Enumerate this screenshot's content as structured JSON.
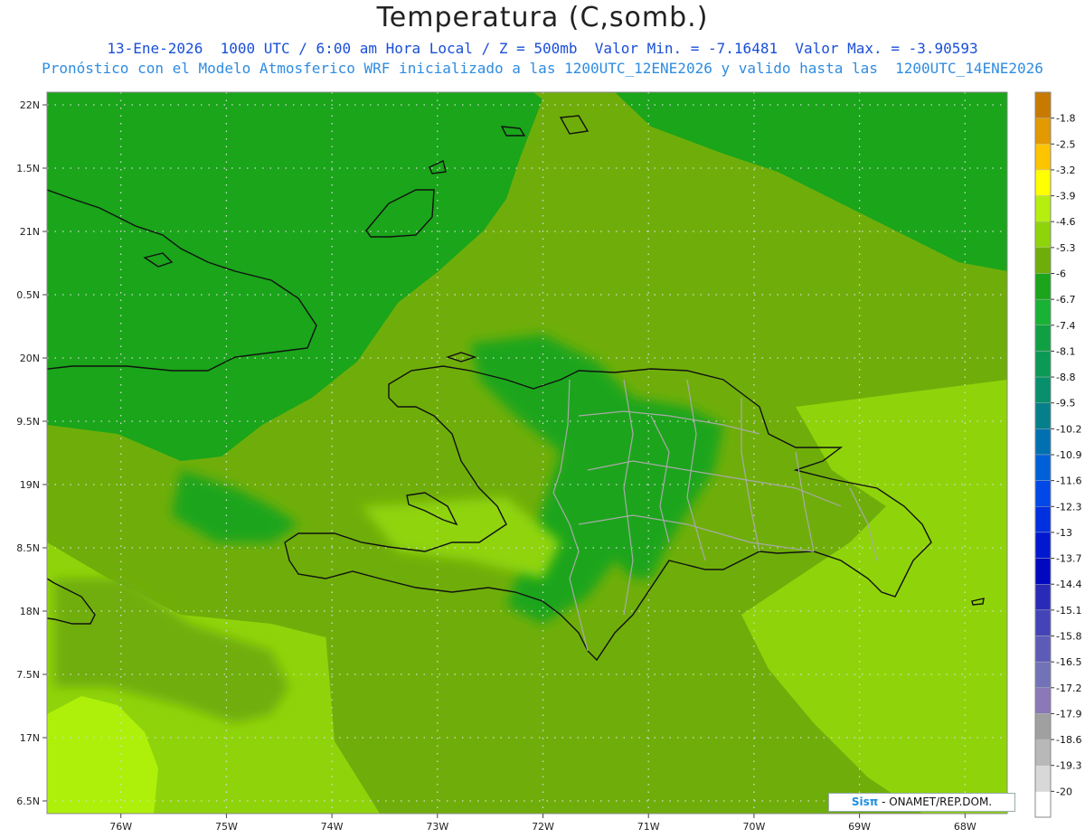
{
  "header": {
    "title": "Temperatura (C,somb.)",
    "line1": "13-Ene-2026  1000 UTC / 6:00 am Hora Local / Z = 500mb  Valor Min. = -7.16481  Valor Max. = -3.90593",
    "line2": "Pronóstico con el Modelo Atmosferico WRF inicializado a las 1200UTC_12ENE2026 y valido hasta las  1200UTC_14ENE2026"
  },
  "map": {
    "lat_range": [
      16.4,
      22.1
    ],
    "lon_range": [
      -76.7,
      -67.6
    ],
    "lat_ticks": [
      {
        "value": 22.0,
        "label": "22N"
      },
      {
        "value": 21.5,
        "label": "1.5N"
      },
      {
        "value": 21.0,
        "label": "21N"
      },
      {
        "value": 20.5,
        "label": "0.5N"
      },
      {
        "value": 20.0,
        "label": "20N"
      },
      {
        "value": 19.5,
        "label": "9.5N"
      },
      {
        "value": 19.0,
        "label": "19N"
      },
      {
        "value": 18.5,
        "label": "8.5N"
      },
      {
        "value": 18.0,
        "label": "18N"
      },
      {
        "value": 17.5,
        "label": "7.5N"
      },
      {
        "value": 17.0,
        "label": "17N"
      },
      {
        "value": 16.5,
        "label": "6.5N"
      }
    ],
    "lon_ticks": [
      {
        "value": -76,
        "label": "76W"
      },
      {
        "value": -75,
        "label": "75W"
      },
      {
        "value": -74,
        "label": "74W"
      },
      {
        "value": -73,
        "label": "73W"
      },
      {
        "value": -72,
        "label": "72W"
      },
      {
        "value": -71,
        "label": "71W"
      },
      {
        "value": -70,
        "label": "70W"
      },
      {
        "value": -69,
        "label": "69W"
      },
      {
        "value": -68,
        "label": "68W"
      }
    ],
    "grid": true,
    "colors": {
      "base": "#6fae0a",
      "dark": "#1aa51a",
      "mid": "#3cb81e",
      "light": "#8fd40a",
      "lighter": "#aef00a",
      "coast": "#111111",
      "provinces": "#a9a9a9"
    }
  },
  "legend": {
    "steps": [
      {
        "label": "-1.8",
        "color": "#c87a00"
      },
      {
        "label": "-2.5",
        "color": "#e29a00"
      },
      {
        "label": "-3.2",
        "color": "#ffc400"
      },
      {
        "label": "-3.9",
        "color": "#ffff00"
      },
      {
        "label": "-4.6",
        "color": "#b5ef10"
      },
      {
        "label": "-5.3",
        "color": "#8fd40a"
      },
      {
        "label": "-6",
        "color": "#6fae0a"
      },
      {
        "label": "-6.7",
        "color": "#1aa51a"
      },
      {
        "label": "-7.4",
        "color": "#18b235"
      },
      {
        "label": "-8.1",
        "color": "#10a044"
      },
      {
        "label": "-8.8",
        "color": "#0b9a55"
      },
      {
        "label": "-9.5",
        "color": "#088f6b"
      },
      {
        "label": "-10.2",
        "color": "#05808a"
      },
      {
        "label": "-10.9",
        "color": "#0070b0"
      },
      {
        "label": "-11.6",
        "color": "#0060d8"
      },
      {
        "label": "-12.3",
        "color": "#0048e8"
      },
      {
        "label": "-13",
        "color": "#0030e0"
      },
      {
        "label": "-13.7",
        "color": "#0018d0"
      },
      {
        "label": "-14.4",
        "color": "#0008c0"
      },
      {
        "label": "-15.1",
        "color": "#2a2ab8"
      },
      {
        "label": "-15.8",
        "color": "#4444b8"
      },
      {
        "label": "-16.5",
        "color": "#5c5cb8"
      },
      {
        "label": "-17.2",
        "color": "#7272b8"
      },
      {
        "label": "-17.9",
        "color": "#8a78b8"
      },
      {
        "label": "-18.6",
        "color": "#a0a0a0"
      },
      {
        "label": "-19.3",
        "color": "#b8b8b8"
      },
      {
        "label": "-20",
        "color": "#d8d8d8"
      },
      {
        "label": "",
        "color": "#ffffff"
      }
    ]
  },
  "credit": {
    "logo": "Sisπ",
    "text": "- ONAMET/REP.DOM."
  }
}
